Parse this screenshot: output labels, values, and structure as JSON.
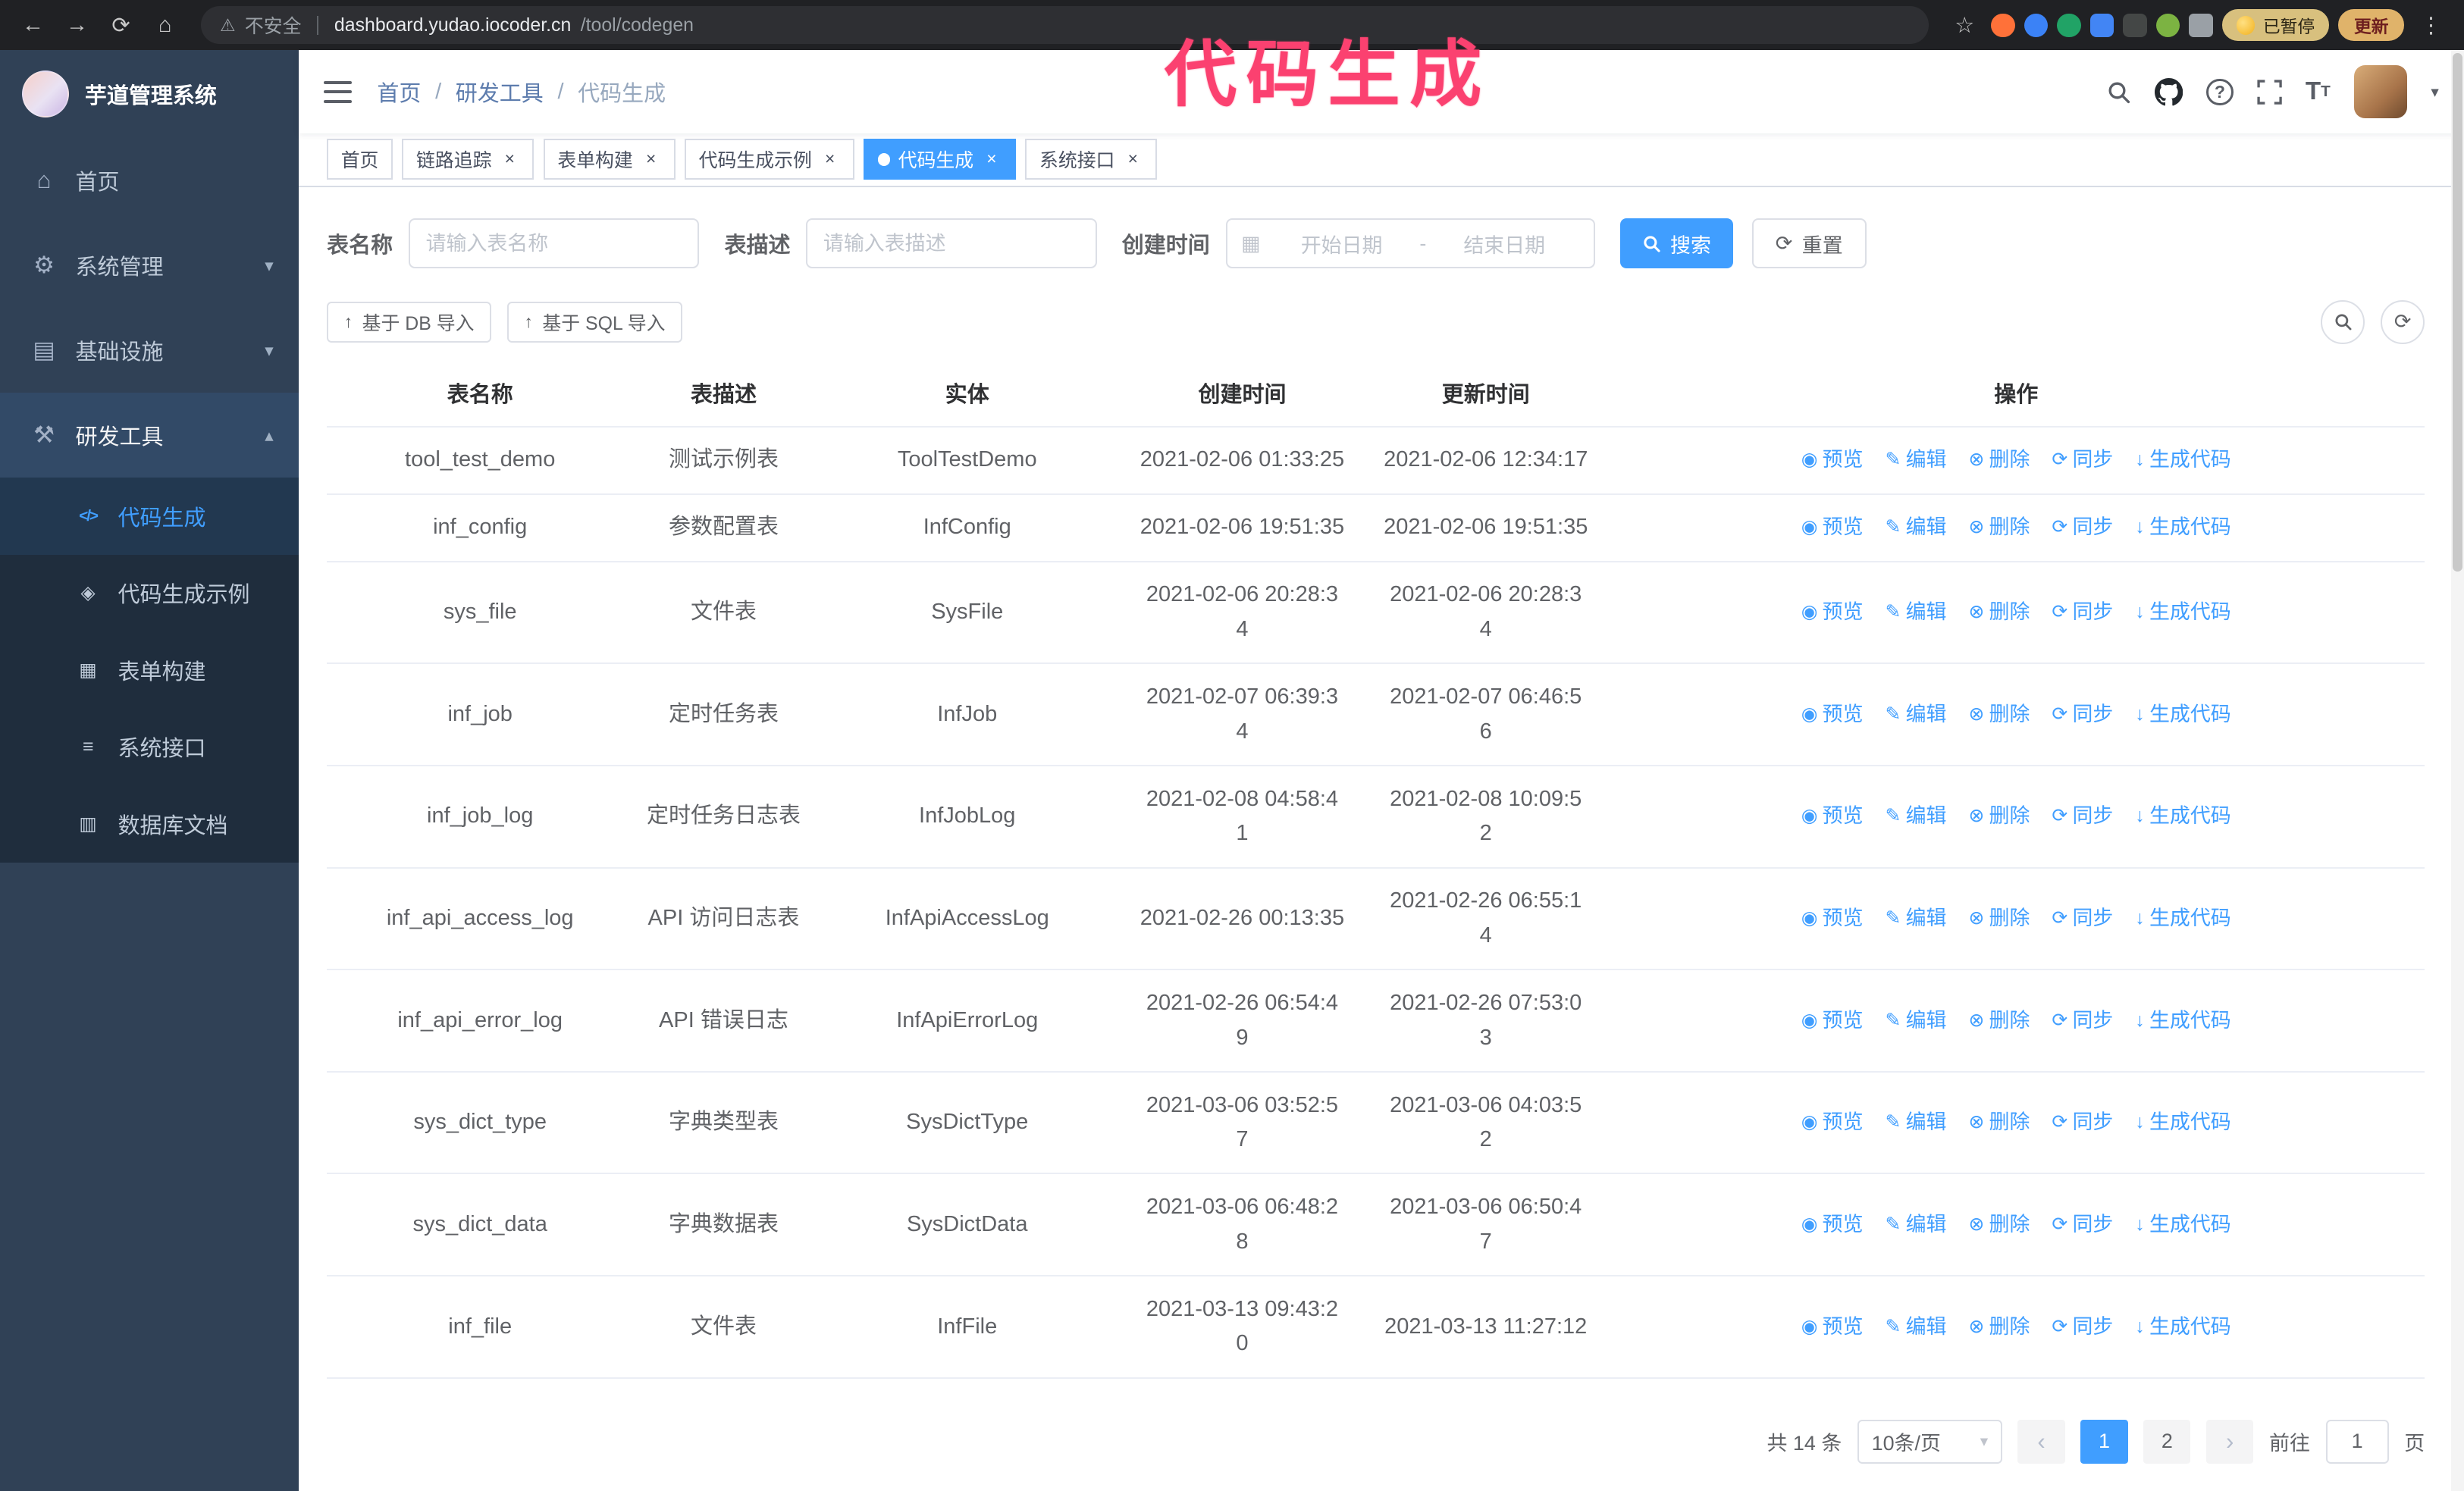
{
  "colors": {
    "accent": "#409eff",
    "sidebar": "#304156",
    "submenu": "#1f2d3d",
    "annotation": "#fb4170"
  },
  "browser": {
    "security_label": "不安全",
    "url_host": "dashboard.yudao.iocoder.cn",
    "url_path": "/tool/codegen",
    "paused_badge": "已暂停",
    "update_button": "更新"
  },
  "annotation": {
    "text": "代码生成"
  },
  "icon_glyphs": {
    "back": "←",
    "forward": "→",
    "reload": "⟳",
    "home": "⌂",
    "warning": "⚠",
    "star": "☆",
    "menu_dots": "⋮",
    "gear": "⚙",
    "infra": "▤",
    "tools": "⚒",
    "code": "</>",
    "example": "◈",
    "form": "▦",
    "api": "≡",
    "db": "▥",
    "chevron_down": "▾",
    "chevron_up": "▴",
    "caret_down": "▾",
    "question": "?",
    "font_big": "T",
    "font_small": "T",
    "calendar": "▦",
    "reset": "⟳",
    "upload": "↑",
    "refresh": "⟳",
    "close": "×",
    "prev": "‹",
    "next": "›"
  },
  "sidebar": {
    "logo_title": "芋道管理系统",
    "items": [
      {
        "label": "首页",
        "icon": "home-icon"
      },
      {
        "label": "系统管理",
        "icon": "gear-icon"
      },
      {
        "label": "基础设施",
        "icon": "infrastructure-icon"
      },
      {
        "label": "研发工具",
        "icon": "tools-icon"
      }
    ],
    "submenu": [
      {
        "label": "代码生成",
        "icon": "code-icon",
        "active": true
      },
      {
        "label": "代码生成示例",
        "icon": "example-icon"
      },
      {
        "label": "表单构建",
        "icon": "form-icon"
      },
      {
        "label": "系统接口",
        "icon": "api-icon"
      },
      {
        "label": "数据库文档",
        "icon": "database-icon"
      }
    ]
  },
  "header": {
    "breadcrumb": [
      "首页",
      "研发工具",
      "代码生成"
    ]
  },
  "tabs": [
    {
      "label": "首页"
    },
    {
      "label": "链路追踪"
    },
    {
      "label": "表单构建"
    },
    {
      "label": "代码生成示例"
    },
    {
      "label": "代码生成",
      "active": true
    },
    {
      "label": "系统接口"
    }
  ],
  "filters": {
    "table_name_label": "表名称",
    "table_name_placeholder": "请输入表名称",
    "table_desc_label": "表描述",
    "table_desc_placeholder": "请输入表描述",
    "create_time_label": "创建时间",
    "date_start_placeholder": "开始日期",
    "date_separator": "-",
    "date_end_placeholder": "结束日期",
    "search_button": "搜索",
    "reset_button": "重置"
  },
  "toolbar": {
    "import_db": "基于 DB 导入",
    "import_sql": "基于 SQL 导入"
  },
  "table": {
    "columns": [
      "表名称",
      "表描述",
      "实体",
      "创建时间",
      "更新时间",
      "操作"
    ],
    "actions": [
      {
        "label": "预览",
        "icon": "eye-icon",
        "glyph": "◉"
      },
      {
        "label": "编辑",
        "icon": "edit-icon",
        "glyph": "✎"
      },
      {
        "label": "删除",
        "icon": "delete-icon",
        "glyph": "⊗"
      },
      {
        "label": "同步",
        "icon": "sync-icon",
        "glyph": "⟳"
      },
      {
        "label": "生成代码",
        "icon": "download-icon",
        "glyph": "↓"
      }
    ],
    "rows": [
      {
        "name": "tool_test_demo",
        "description": "测试示例表",
        "entity": "ToolTestDemo",
        "create_time": "2021-02-06 01:33:25",
        "update_time": "2021-02-06 12:34:17"
      },
      {
        "name": "inf_config",
        "description": "参数配置表",
        "entity": "InfConfig",
        "create_time": "2021-02-06 19:51:35",
        "update_time": "2021-02-06 19:51:35"
      },
      {
        "name": "sys_file",
        "description": "文件表",
        "entity": "SysFile",
        "create_time": "2021-02-06 20:28:3\n4",
        "update_time": "2021-02-06 20:28:3\n4"
      },
      {
        "name": "inf_job",
        "description": "定时任务表",
        "entity": "InfJob",
        "create_time": "2021-02-07 06:39:3\n4",
        "update_time": "2021-02-07 06:46:5\n6"
      },
      {
        "name": "inf_job_log",
        "description": "定时任务日志表",
        "entity": "InfJobLog",
        "create_time": "2021-02-08 04:58:4\n1",
        "update_time": "2021-02-08 10:09:5\n2"
      },
      {
        "name": "inf_api_access_log",
        "description": "API 访问日志表",
        "entity": "InfApiAccessLog",
        "create_time": "2021-02-26 00:13:35",
        "update_time": "2021-02-26 06:55:1\n4"
      },
      {
        "name": "inf_api_error_log",
        "description": "API 错误日志",
        "entity": "InfApiErrorLog",
        "create_time": "2021-02-26 06:54:4\n9",
        "update_time": "2021-02-26 07:53:0\n3"
      },
      {
        "name": "sys_dict_type",
        "description": "字典类型表",
        "entity": "SysDictType",
        "create_time": "2021-03-06 03:52:5\n7",
        "update_time": "2021-03-06 04:03:5\n2"
      },
      {
        "name": "sys_dict_data",
        "description": "字典数据表",
        "entity": "SysDictData",
        "create_time": "2021-03-06 06:48:2\n8",
        "update_time": "2021-03-06 06:50:4\n7"
      },
      {
        "name": "inf_file",
        "description": "文件表",
        "entity": "InfFile",
        "create_time": "2021-03-13 09:43:2\n0",
        "update_time": "2021-03-13 11:27:12"
      }
    ]
  },
  "pagination": {
    "total": "共 14 条",
    "page_size": "10条/页",
    "pages": [
      "1",
      "2"
    ],
    "goto_label": "前往",
    "goto_value": "1",
    "goto_suffix": "页"
  }
}
